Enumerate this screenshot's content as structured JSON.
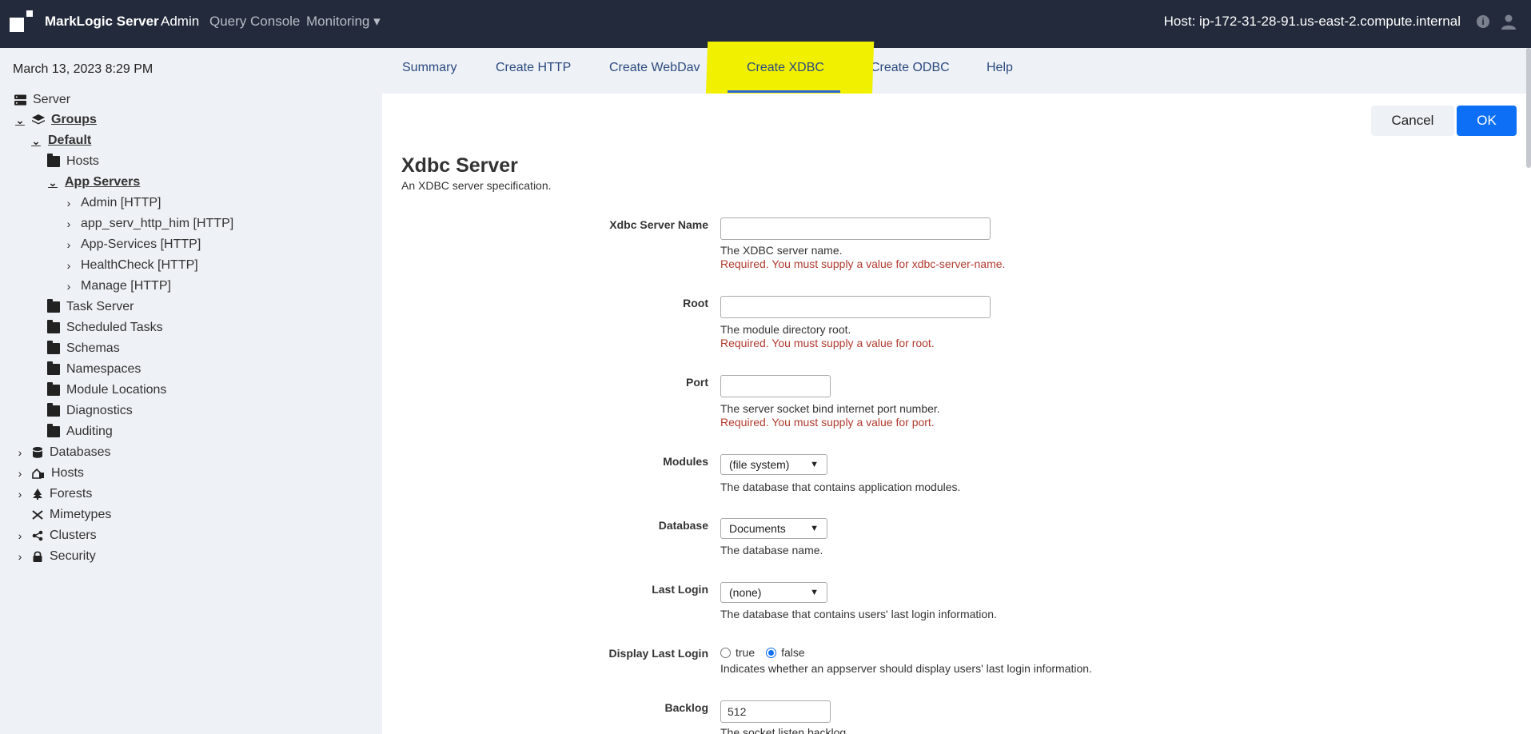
{
  "topbar": {
    "brand": "MarkLogic Server",
    "nav_admin": "Admin",
    "nav_query_console": "Query Console",
    "nav_monitoring": "Monitoring ▾",
    "host": "Host: ip-172-31-28-91.us-east-2.compute.internal",
    "info_icon": "i"
  },
  "sidebar": {
    "date": "March 13, 2023 8:29 PM",
    "server": "Server",
    "groups": "Groups",
    "default": "Default",
    "hosts_folder": "Hosts",
    "app_servers": "App Servers",
    "admin_http": "Admin [HTTP]",
    "app_serv_http_him": "app_serv_http_him [HTTP]",
    "app_services_http": "App-Services [HTTP]",
    "healthcheck_http": "HealthCheck [HTTP]",
    "manage_http": "Manage [HTTP]",
    "task_server": "Task Server",
    "scheduled_tasks": "Scheduled Tasks",
    "schemas": "Schemas",
    "namespaces": "Namespaces",
    "module_locations": "Module Locations",
    "diagnostics": "Diagnostics",
    "auditing": "Auditing",
    "databases": "Databases",
    "hosts": "Hosts",
    "forests": "Forests",
    "mimetypes": "Mimetypes",
    "clusters": "Clusters",
    "security": "Security"
  },
  "tabs": {
    "summary": "Summary",
    "create_http": "Create HTTP",
    "create_webdav": "Create WebDav",
    "create_xdbc": "Create XDBC",
    "create_odbc": "Create ODBC",
    "help": "Help"
  },
  "actions": {
    "cancel": "Cancel",
    "ok": "OK"
  },
  "form": {
    "title": "Xdbc Server",
    "subtitle": "An XDBC server specification.",
    "server_name_label": "Xdbc Server Name",
    "server_name_value": "",
    "server_name_help": "The XDBC server name.",
    "server_name_error": "Required. You must supply a value for xdbc-server-name.",
    "root_label": "Root",
    "root_value": "",
    "root_help": "The module directory root.",
    "root_error": "Required. You must supply a value for root.",
    "port_label": "Port",
    "port_value": "",
    "port_help": "The server socket bind internet port number.",
    "port_error": "Required. You must supply a value for port.",
    "modules_label": "Modules",
    "modules_value": "(file system)",
    "modules_help": "The database that contains application modules.",
    "database_label": "Database",
    "database_value": "Documents",
    "database_help": "The database name.",
    "last_login_label": "Last Login",
    "last_login_value": "(none)",
    "last_login_help": "The database that contains users' last login information.",
    "display_last_login_label": "Display Last Login",
    "display_true": "true",
    "display_false": "false",
    "display_last_login_selected": "false",
    "display_last_login_help": "Indicates whether an appserver should display users' last login information.",
    "backlog_label": "Backlog",
    "backlog_value": "512",
    "backlog_help": "The socket listen backlog."
  }
}
